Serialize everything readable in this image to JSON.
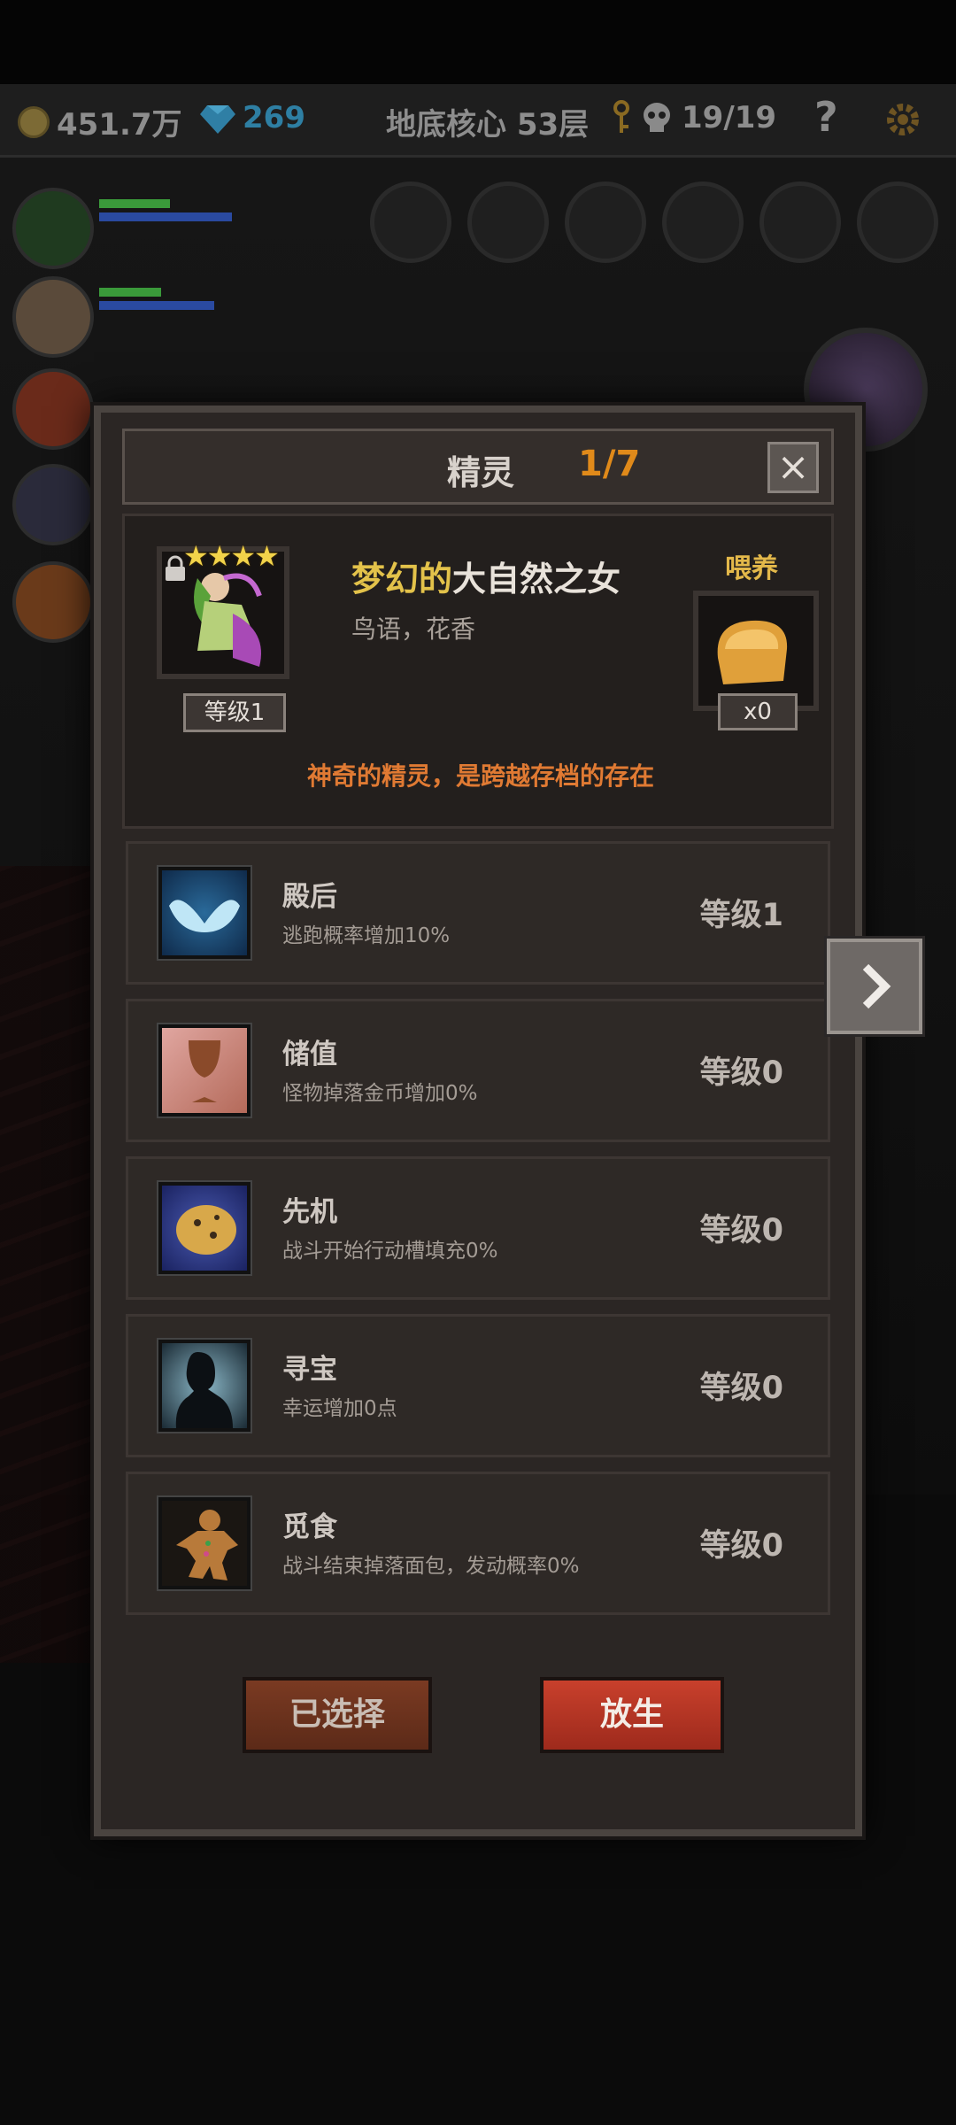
{
  "topbar": {
    "coins": "451.7万",
    "gems": "269",
    "location": "地底核心 53层",
    "kills": "19/19",
    "help": "?"
  },
  "dialog": {
    "title": "精灵",
    "page": "1/7",
    "close": "×",
    "elf": {
      "stars": "★★★★",
      "name_highlight": "梦幻的",
      "name_rest": "大自然之女",
      "subtitle": "鸟语，花香",
      "level": "等级1",
      "description": "神奇的精灵，是跨越存档的存在"
    },
    "feed": {
      "label": "喂养",
      "count": "x0"
    },
    "skills": [
      {
        "name": "殿后",
        "desc": "逃跑概率增加10%",
        "level": "等级1",
        "icon": "wings-icon"
      },
      {
        "name": "储值",
        "desc": "怪物掉落金币增加0%",
        "level": "等级0",
        "icon": "goblet-icon"
      },
      {
        "name": "先机",
        "desc": "战斗开始行动槽填充0%",
        "level": "等级0",
        "icon": "leopard-icon"
      },
      {
        "name": "寻宝",
        "desc": "幸运增加0点",
        "level": "等级0",
        "icon": "silhouette-icon"
      },
      {
        "name": "觅食",
        "desc": "战斗结束掉落面包，发动概率0%",
        "level": "等级0",
        "icon": "gingerbread-icon"
      }
    ],
    "buttons": {
      "selected": "已选择",
      "release": "放生"
    }
  },
  "colors": {
    "accent_orange": "#e08a1a",
    "gold_text": "#e3c24a",
    "desc_orange": "#e07a33",
    "release_red": "#c8402c"
  }
}
